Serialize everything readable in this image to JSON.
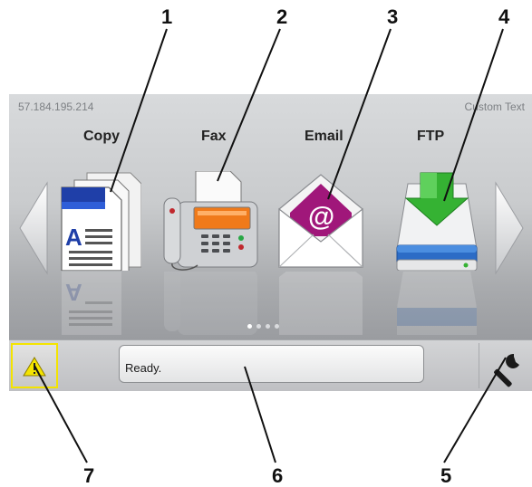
{
  "callouts": [
    "1",
    "2",
    "3",
    "4",
    "5",
    "6",
    "7"
  ],
  "header": {
    "ip_address": "57.184.195.214",
    "custom_text": "Custom Text"
  },
  "apps": [
    {
      "label": "Copy",
      "icon": "copy-icon"
    },
    {
      "label": "Fax",
      "icon": "fax-icon"
    },
    {
      "label": "Email",
      "icon": "email-icon"
    },
    {
      "label": "FTP",
      "icon": "ftp-icon"
    }
  ],
  "pager": {
    "pages": 4,
    "current": 1
  },
  "status": {
    "message": "Ready.",
    "warning_icon": "warning-icon",
    "settings_icon": "wrench-icon"
  },
  "colors": {
    "warning_border": "#f4e400",
    "email_accent": "#a0177a",
    "ftp_arrow": "#35b233",
    "fax_screen": "#f07a1a",
    "copy_blue": "#1f3fa8"
  }
}
